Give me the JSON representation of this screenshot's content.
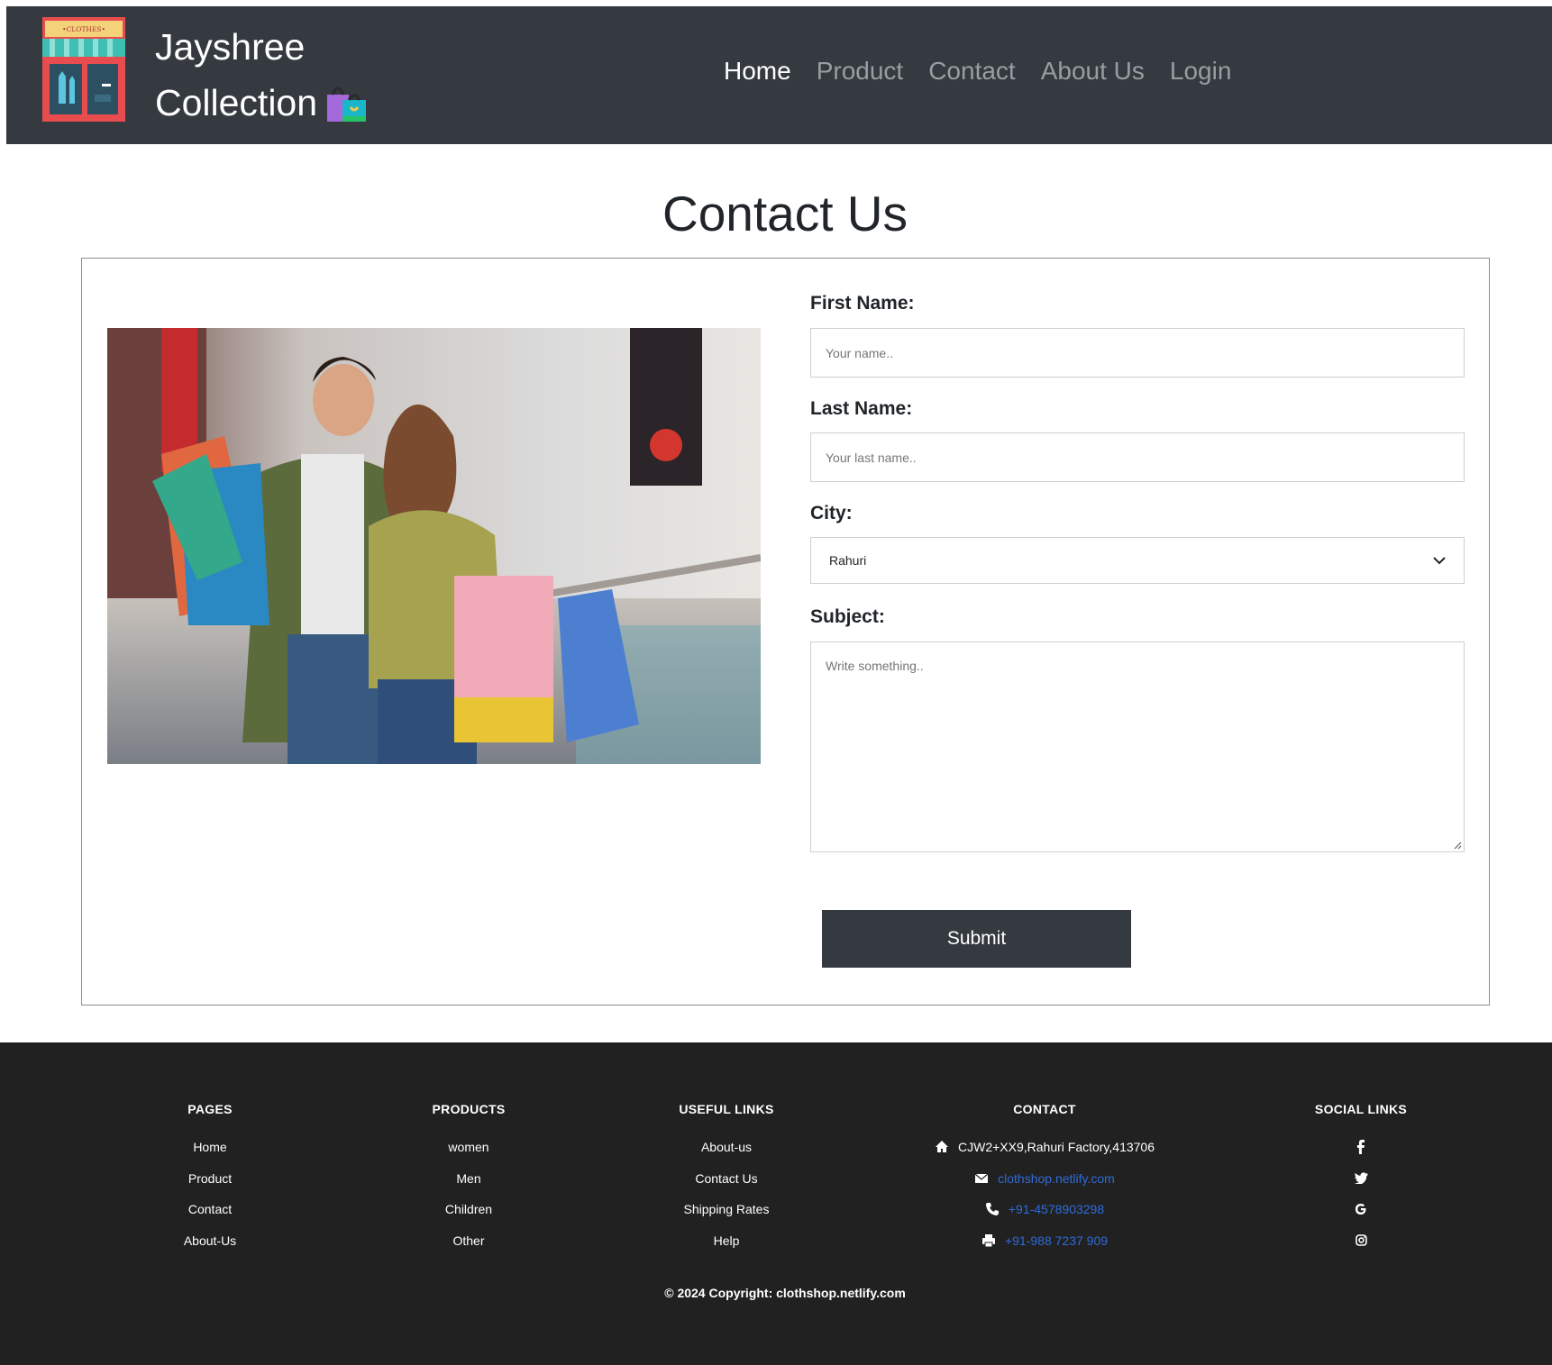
{
  "header": {
    "brand_line1": "Jayshree",
    "brand_line2": "Collection",
    "logo_sign": "•CLOTHES•",
    "nav": [
      {
        "label": "Home",
        "active": true
      },
      {
        "label": "Product",
        "active": false
      },
      {
        "label": "Contact",
        "active": false
      },
      {
        "label": "About Us",
        "active": false
      },
      {
        "label": "Login",
        "active": false
      }
    ]
  },
  "page_title": "Contact Us",
  "form": {
    "first_name_label": "First Name:",
    "first_name_placeholder": "Your name..",
    "last_name_label": "Last Name:",
    "last_name_placeholder": "Your last name..",
    "city_label": "City:",
    "city_value": "Rahuri",
    "subject_label": "Subject:",
    "subject_placeholder": "Write something..",
    "submit_label": "Submit"
  },
  "footer": {
    "pages": {
      "heading": "PAGES",
      "items": [
        "Home",
        "Product",
        "Contact",
        "About-Us"
      ]
    },
    "products": {
      "heading": "PRODUCTS",
      "items": [
        "women",
        "Men",
        "Children",
        "Other"
      ]
    },
    "useful_links": {
      "heading": "USEFUL LINKS",
      "items": [
        "About-us",
        "Contact Us",
        "Shipping Rates",
        "Help"
      ]
    },
    "contact": {
      "heading": "CONTACT",
      "address": "CJW2+XX9,Rahuri Factory,413706",
      "email": "clothshop.netlify.com",
      "phone": "+91-4578903298",
      "fax": "+91-988 7237 909"
    },
    "social": {
      "heading": "SOCIAL LINKS",
      "icons": [
        "facebook-icon",
        "twitter-icon",
        "google-icon",
        "instagram-icon"
      ]
    },
    "copyright": "© 2024 Copyright: clothshop.netlify.com"
  },
  "colors": {
    "navbar_bg": "#343a40",
    "footer_bg": "#212121",
    "link_blue": "#2f6bd9",
    "button_bg": "#343a40"
  }
}
